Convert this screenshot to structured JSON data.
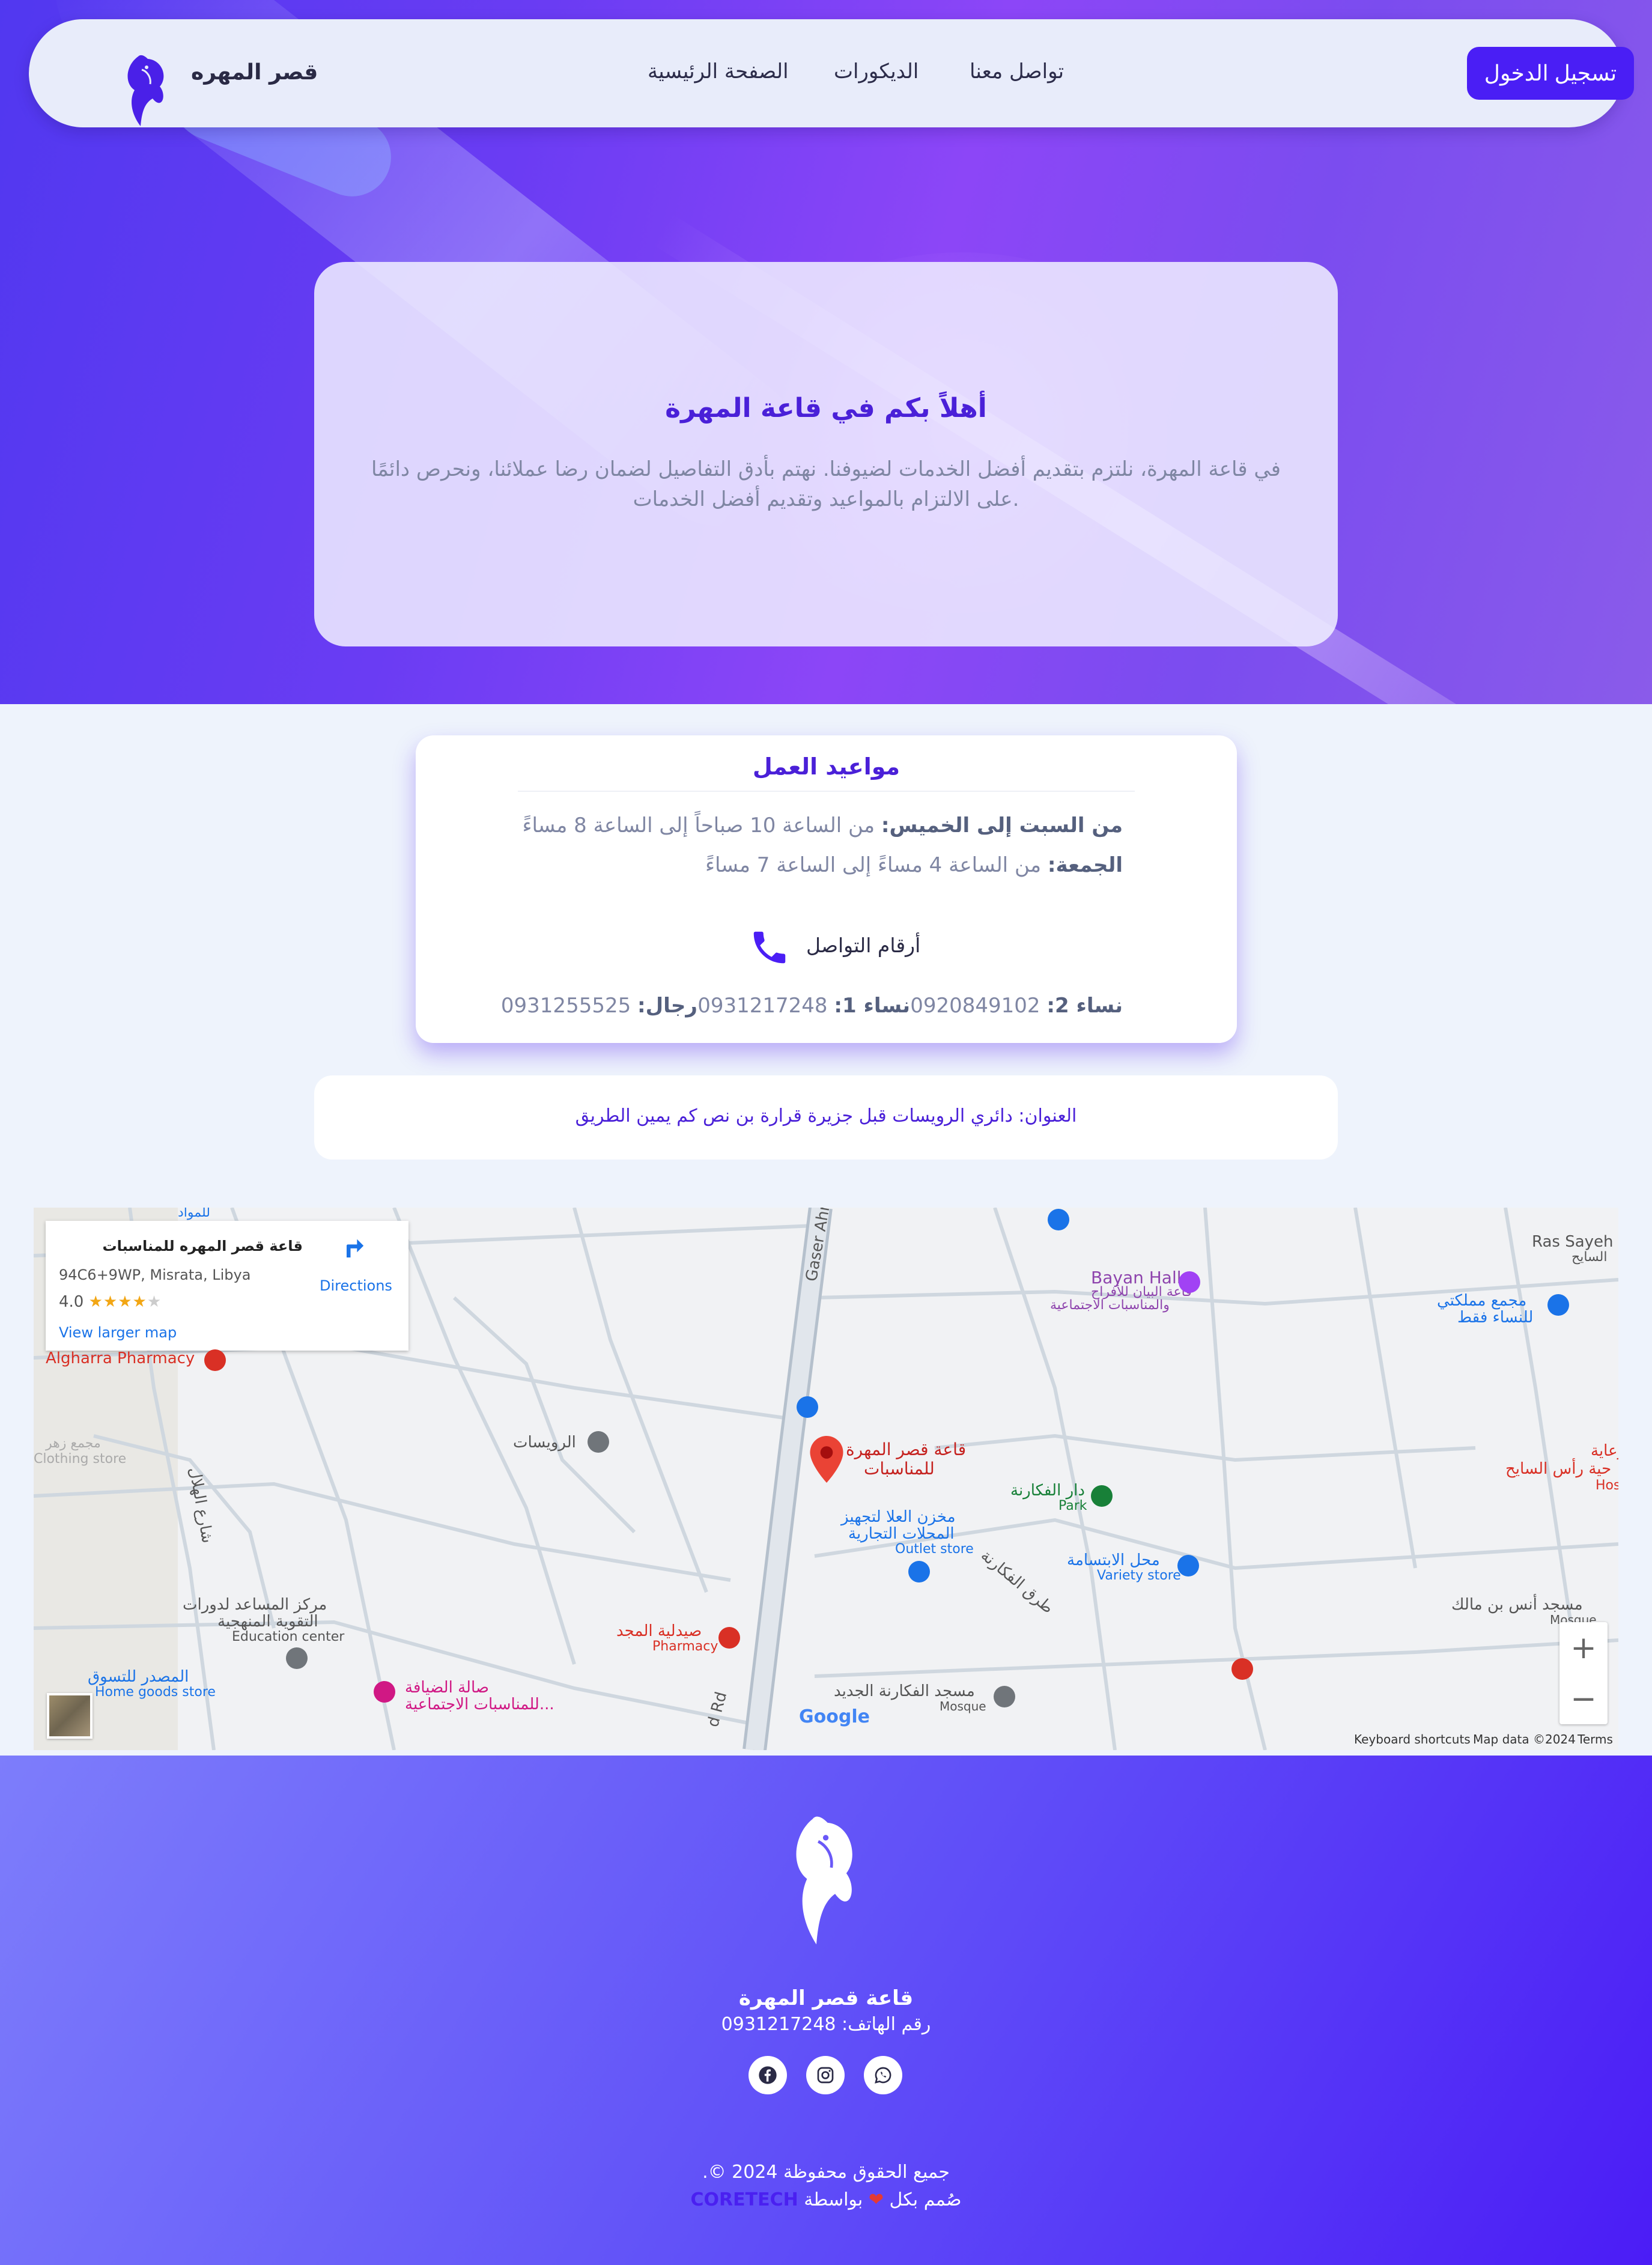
{
  "navbar": {
    "brand": "قصر المهره",
    "links": [
      "الصفحة الرئيسية",
      "الديكورات",
      "تواصل معنا"
    ],
    "login": "تسجيل الدخول"
  },
  "welcome": {
    "title": "أهلاً بكم في قاعة المهرة",
    "text_line1": "في قاعة المهرة، نلتزم بتقديم أفضل الخدمات لضيوفنا. نهتم بأدق التفاصيل لضمان رضا عملائنا، ونحرص دائمًا",
    "text_line2": ".على الالتزام بالمواعيد وتقديم أفضل الخدمات"
  },
  "hours": {
    "title": "مواعيد العمل",
    "weekday_label": "من السبت إلى الخميس:",
    "weekday_value": "من الساعة 10 صباحاً إلى الساعة 8 مساءً",
    "friday_label": "الجمعة:",
    "friday_value": "من الساعة 4 مساءً إلى الساعة 7 مساءً",
    "contact_title": "أرقام التواصل",
    "phones": [
      {
        "label": "نساء 2:",
        "number": "0920849102"
      },
      {
        "label": "نساء 1:",
        "number": "0931217248"
      },
      {
        "label": "رجال:",
        "number": "0931255525"
      }
    ]
  },
  "address": "العنوان: دائري الرويسات قبل جزيرة قرارة بن نص كم يمين الطريق",
  "map": {
    "place_name": "قاعة قصر المهره للمناسبات",
    "plus_code": "94C6+9WP, Misrata, Libya",
    "rating": "4.0",
    "directions": "Directions",
    "larger_map": "View larger map",
    "marker_label_line1": "قاعة قصر المهرة",
    "marker_label_line2": "للمناسبات",
    "labels": {
      "gaser_ahmed": "Gaser Ahmed",
      "bayan_hall": "Bayan Hall",
      "bayan_ar1": "قاعة البيان للأفراح",
      "bayan_ar2": "والمناسبات الاجتماعية",
      "ras_sayeh": "Ras Sayeh N",
      "ras_sayeh_ar": "السايح",
      "mujamma": "مجمع مملكتي",
      "mujamma2": "للنساء فقط",
      "ruwaisat": "الرويسات",
      "dar_fakarna": "دار الفكارنة",
      "park": "Park",
      "makhzan1": "مخزن العلا لتجهيز",
      "makhzan2": "المحلات التجارية",
      "outlet": "Outlet store",
      "ibtisama": "محل الابتسامة",
      "variety": "Variety store",
      "tariq_fakarna": "طرق الفكارنة",
      "anas_mosque": "مسجد أنس بن مالك",
      "mosque": "Mosque",
      "markaz1": "مركز المساعد لدورات",
      "markaz2": "التقوية المنهجية",
      "edu": "Education center",
      "pharmacy_ar": "صيدلية المجد",
      "pharmacy": "Pharmacy",
      "fakarna_mosque": "مسجد الفكارنة الجديد",
      "diyafa1": "صالة الضيافة",
      "diyafa2": "للمناسبات الاجتماعية...",
      "masdar": "المصدر للتسوق",
      "home_goods": "Home goods store",
      "alhilal": "شارع الهلال",
      "algharra": "Algharra Pharmacy",
      "majma_zahr": "مجمع زهر",
      "clothing": "Clothing store",
      "right_edge1": "الرعاية",
      "right_edge2": "حية رأس السايح",
      "right_edge3": "Hos",
      "for_mawad": "للمواد",
      "rd": "d Rd"
    },
    "google": "Google",
    "keyboard": "Keyboard shortcuts",
    "mapdata": "Map data ©2024",
    "terms": "Terms"
  },
  "footer": {
    "name": "قاعة قصر المهرة",
    "phone": "رقم الهاتف: 0931217248",
    "copyright": "جميع الحقوق محفوظة 2024 ©.",
    "credit_pre": "صُمم بكل",
    "credit_by": "بواسطة",
    "credit_brand": "CORETECH"
  },
  "colors": {
    "accent": "#4a1ef5",
    "text_muted": "#7f86a3",
    "hero_start": "#5138f0",
    "hero_end": "#8a5bea",
    "footer_start": "#7d7dfb",
    "footer_end": "#4b1cf6",
    "map_marker": "#ea4335",
    "heart": "#e53935"
  },
  "icons": [
    "horse-logo-icon",
    "phone-icon",
    "directions-icon",
    "map-marker-icon",
    "facebook-icon",
    "instagram-icon",
    "whatsapp-icon",
    "heart-icon",
    "zoom-in-icon",
    "zoom-out-icon"
  ]
}
